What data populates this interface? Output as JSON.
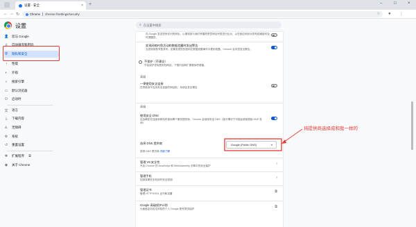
{
  "browser": {
    "tab_title": "设置 - 安全",
    "tab_close": "×",
    "new_tab": "+",
    "chip_label": "Chrome",
    "url": "chrome://settings/security",
    "back": "←",
    "forward": "→",
    "reload": "↻",
    "star": "☆",
    "window_controls": [
      "–",
      "□",
      "×"
    ]
  },
  "header": {
    "title": "设置",
    "search_placeholder": "在设置中搜索"
  },
  "sidebar": {
    "items": [
      {
        "label": "您与 Google",
        "icon": "person-icon",
        "glyph": "👤"
      },
      {
        "label": "自动填充和密码",
        "icon": "key-icon",
        "glyph": "⚷"
      },
      {
        "label": "隐私和安全",
        "icon": "shield-icon",
        "glyph": "⛨",
        "active": true
      },
      {
        "label": "性能",
        "icon": "speedometer-icon",
        "glyph": "◔"
      },
      {
        "label": "外观",
        "icon": "palette-icon",
        "glyph": "◐"
      },
      {
        "label": "搜索引擎",
        "icon": "search-icon",
        "glyph": "⌕"
      },
      {
        "label": "默认浏览器",
        "icon": "browser-icon",
        "glyph": "▭"
      },
      {
        "label": "启动时",
        "icon": "power-icon",
        "glyph": "⏻"
      },
      {
        "label": "语言",
        "icon": "language-icon",
        "glyph": "文"
      },
      {
        "label": "下载内容",
        "icon": "download-icon",
        "glyph": "⤓"
      },
      {
        "label": "无障碍",
        "icon": "accessibility-icon",
        "glyph": "♿"
      },
      {
        "label": "系统",
        "icon": "wrench-icon",
        "glyph": "⚙"
      },
      {
        "label": "重置设置",
        "icon": "reset-icon",
        "glyph": "↺"
      },
      {
        "label": "扩展程序",
        "icon": "puzzle-icon",
        "glyph": "✚",
        "external": "⧉"
      },
      {
        "label": "关于 Chrome",
        "icon": "chrome-icon",
        "glyph": "◉"
      }
    ]
  },
  "content": {
    "top_desc": "向 Google 发送您所访问的网址，以便将其与我们掌握的恶意网址列表进行比对，以在相应网页对您构成威胁时及时提醒您。",
    "enhanced_protection": {
      "title": "发现网络钓鱼活动和数据泄露时发出警告",
      "desc": "当您使用账号登录时，如果发现您的密码在数据泄露事件中遭到泄露，Chrome 会向您发出警告。"
    },
    "no_protection": {
      "title": "不保护（不建议）",
      "desc": "不会保护您免受危险网站、下载内容和扩展程序的侵害。"
    },
    "advanced_label": "高级",
    "https_first": {
      "title": "一律使用安全连接",
      "desc": "在导航到不支持安全连接的网站前，系统会发出警告"
    },
    "misc_label": "高级",
    "secure_dns": {
      "title": "使用安全 DNS",
      "desc": "这会确定在连接到网站时使用哪个服务提供商。Chrome 会使用安全 DNS（部分情况下可能会使用原始 DNS 查询）"
    },
    "dns_provider_label": "选择 DNS 提供商",
    "dns_provider_value": "Google (Public DNS)",
    "dns_link_text": "选择 DNS 提供商",
    "dns_link_suffix": "详细了解",
    "manage_v8": {
      "title": "管理 V8 安全性",
      "desc": "开启 Chrome 的 JavaScript 和 WebAssembly 引擎中的安全保护"
    },
    "manage_phones": {
      "title": "管理手机",
      "desc": "控制将哪些手机用作安全密钥"
    },
    "manage_certs": {
      "title": "管理证书",
      "desc": "管理 HTTPS/SSL 证书和设置"
    },
    "google_advanced_protection": {
      "title": "Google 高级保护计划",
      "desc": "为面临定向攻击风险的个人 Google 账号提供保护"
    }
  },
  "annotation": {
    "text": "将提供商选择成和我一样的",
    "color": "#e53935"
  }
}
